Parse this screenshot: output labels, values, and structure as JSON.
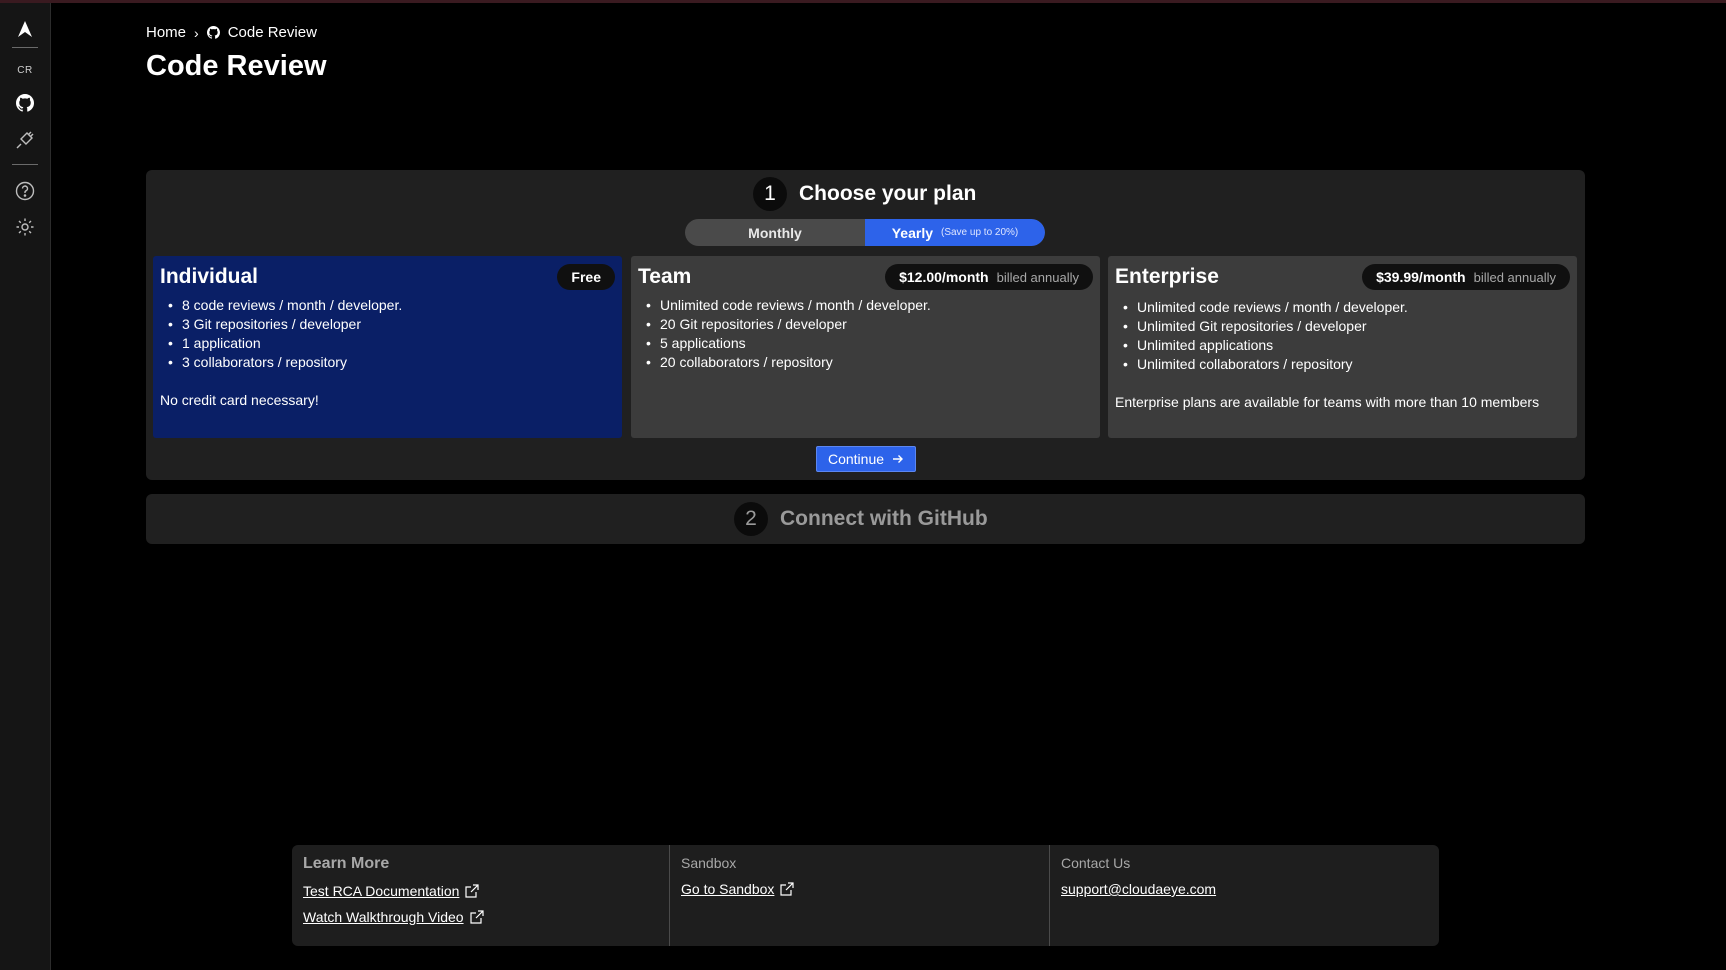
{
  "breadcrumb": {
    "home": "Home",
    "separator": "›",
    "current": "Code Review"
  },
  "page": {
    "title": "Code Review"
  },
  "sidebar": {
    "cr_label": "CR"
  },
  "step1": {
    "number": "1",
    "title": "Choose your plan",
    "billing_toggle": {
      "monthly": "Monthly",
      "yearly": "Yearly",
      "yearly_note": "(Save up to 20%)",
      "selected": "Yearly"
    },
    "plans": [
      {
        "name": "Individual",
        "badge": "Free",
        "features": [
          "8 code reviews / month / developer.",
          "3 Git repositories / developer",
          "1 application",
          "3 collaborators / repository"
        ],
        "note": "No credit card necessary!",
        "selected": true
      },
      {
        "name": "Team",
        "price": "$12.00/month",
        "billing": "billed annually",
        "features": [
          "Unlimited code reviews / month / developer.",
          "20 Git repositories / developer",
          "5 applications",
          "20 collaborators / repository"
        ]
      },
      {
        "name": "Enterprise",
        "price": "$39.99/month",
        "billing": "billed annually",
        "features": [
          "Unlimited code reviews / month / developer.",
          "Unlimited Git repositories / developer",
          "Unlimited applications",
          "Unlimited collaborators / repository"
        ],
        "note": "Enterprise plans are available for teams with more than 10 members"
      }
    ],
    "continue_label": "Continue"
  },
  "step2": {
    "number": "2",
    "title": "Connect with GitHub"
  },
  "footer": {
    "learn_more": {
      "title": "Learn More",
      "links": [
        "Test RCA Documentation",
        "Watch Walkthrough Video"
      ]
    },
    "sandbox": {
      "title": "Sandbox",
      "link": "Go to Sandbox"
    },
    "contact": {
      "title": "Contact Us",
      "email": "support@cloudaeye.com"
    }
  },
  "colors": {
    "accent": "#2d63ea",
    "selected_card": "#0a1f66",
    "panel": "#202020",
    "card": "#3c3c3c"
  }
}
